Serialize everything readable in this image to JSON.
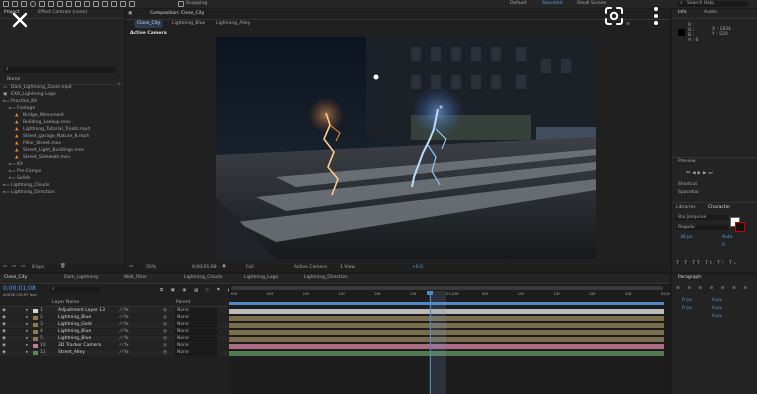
{
  "topbar": {
    "workspaces": [
      "Default",
      "Standard",
      "Small Screen"
    ],
    "snapping": "Snapping",
    "search_placeholder": "Search Help"
  },
  "project_panel": {
    "tabs": [
      "Project",
      "Effect Controls (none)"
    ],
    "search_placeholder": "",
    "column_name": "Name",
    "items": [
      {
        "label": "Dark_Lightning_Zoom.mp4",
        "indent": 0,
        "kind": "footage"
      },
      {
        "label": "EXO_Lightning Logo",
        "indent": 0,
        "kind": "comp"
      },
      {
        "label": "Practice_Kit",
        "indent": 0,
        "kind": "folder"
      },
      {
        "label": "Footage",
        "indent": 1,
        "kind": "folder"
      },
      {
        "label": "Bridge_Monument",
        "indent": 2,
        "kind": "cone"
      },
      {
        "label": "Building_Lookup.mov",
        "indent": 2,
        "kind": "cone"
      },
      {
        "label": "Lightning_Tutorial_Treats.mp4",
        "indent": 2,
        "kind": "cone"
      },
      {
        "label": "Street_garage_Nature_8.mp4",
        "indent": 2,
        "kind": "cone"
      },
      {
        "label": "Pillar_Street.mov",
        "indent": 2,
        "kind": "cone"
      },
      {
        "label": "Street_Light_Buildings.mov",
        "indent": 2,
        "kind": "cone"
      },
      {
        "label": "Street_Sidewalk.mov",
        "indent": 2,
        "kind": "cone"
      },
      {
        "label": "Kit",
        "indent": 1,
        "kind": "folder"
      },
      {
        "label": "Pre-Comps",
        "indent": 1,
        "kind": "folder"
      },
      {
        "label": "Solids",
        "indent": 1,
        "kind": "folder"
      },
      {
        "label": "Lightning_Clouds",
        "indent": 0,
        "kind": "folder"
      },
      {
        "label": "Lightning_Direction",
        "indent": 0,
        "kind": "folder"
      }
    ],
    "bpc": "8 bpc"
  },
  "composition": {
    "title": "Composition: Close_City",
    "tabs": [
      "Close_City",
      "Lightning_Blue",
      "Lightning_Alley"
    ],
    "label": "Active Camera",
    "zoom": "50%",
    "timecode": "0;00;01;08",
    "resolution": "Full",
    "camera": "Active Camera",
    "views": "1 View",
    "exposure": "+0.0"
  },
  "right_panels": {
    "info_tab": "Info",
    "audio_tab": "Audio",
    "info_lines": [
      "R :",
      "G :",
      "B :",
      "A : 0"
    ],
    "coords": [
      "X : 1834",
      "Y : 520"
    ],
    "preview_tab": "Preview",
    "shortcut_label": "Shortcut",
    "shortcut_value": "Spacebar",
    "libraries_tab": "Libraries",
    "character_tab": "Character",
    "font_name": "Bai Jamjuree",
    "font_style": "Regular",
    "font_size": "36 px",
    "leading": "Auto",
    "tracking": "0",
    "paragraph_tab": "Paragraph",
    "para_values": [
      "0 px",
      "0 px",
      "0 px",
      "0 px",
      "0 px"
    ]
  },
  "timeline": {
    "tabs": [
      "Close_City",
      "Dark_Lightning",
      "Wall_Filter",
      "Lightning_Clouds",
      "Lightning_Logo",
      "Lightning_Direction"
    ],
    "timecode": "0;00;01;08",
    "timecode_sub": "00038 (29.97 fps)",
    "search_placeholder": "",
    "columns": [
      "Layer Name",
      "Parent"
    ],
    "ruler_ticks": [
      "00f",
      "05f",
      "10f",
      "15f",
      "20f",
      "25f",
      "01;00f",
      "05f",
      "10f",
      "15f",
      "20f",
      "25f",
      "02;00f"
    ],
    "layers": [
      {
        "num": "1",
        "name": "Adjustment Layer 13",
        "parent": "None",
        "color": "#d6d6d6"
      },
      {
        "num": "2",
        "name": "Lightning_Blue",
        "parent": "None",
        "color": "#8a7b56"
      },
      {
        "num": "3",
        "name": "Lightning_Gold",
        "parent": "None",
        "color": "#8a7b56"
      },
      {
        "num": "4",
        "name": "Lightning_Blue",
        "parent": "None",
        "color": "#8a7b56"
      },
      {
        "num": "5",
        "name": "Lightning_Blue",
        "parent": "None",
        "color": "#8a7b56"
      },
      {
        "num": "10",
        "name": "3D Tracker Camera",
        "parent": "None",
        "color": "#c77a94"
      },
      {
        "num": "11",
        "name": "Street_Alley",
        "parent": "None",
        "color": "#5d8a5a"
      }
    ]
  },
  "overlay": {
    "close_icon": "close-icon",
    "lens_icon": "google-lens-icon",
    "more_icon": "more-vertical-icon"
  }
}
